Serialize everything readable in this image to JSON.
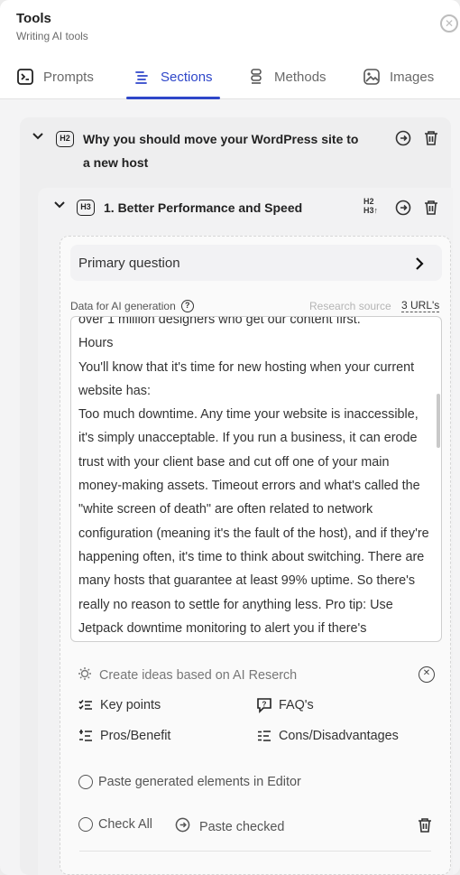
{
  "header": {
    "title": "Tools",
    "subtitle": "Writing AI tools",
    "close_icon": "close-circle-icon"
  },
  "tabs": [
    {
      "label": "Prompts",
      "icon": "prompt-terminal-icon",
      "active": false
    },
    {
      "label": "Sections",
      "icon": "sections-list-icon",
      "active": true
    },
    {
      "label": "Methods",
      "icon": "methods-stack-icon",
      "active": false
    },
    {
      "label": "Images",
      "icon": "image-icon",
      "active": false
    }
  ],
  "h2": {
    "badge": "H2",
    "title": "Why you should move your WordPress site to a new host"
  },
  "h3": {
    "badge": "H3",
    "title": "1. Better Performance and Speed",
    "convert_top": "H2",
    "convert_bottom": "H3↑"
  },
  "primary_question": {
    "label": "Primary question"
  },
  "data": {
    "label": "Data for AI generation",
    "research_label": "Research source",
    "research_link": "3 URL's",
    "text": "over 1 million designers who get our content first.\nHours\nYou'll know that it's time for new hosting when your current website has:\nToo much downtime. Any time your website is inaccessible, it's simply unacceptable. If you run a business, it can erode trust with your client base and cut off one of your main money-making assets. Timeout errors and what's called the \"white screen of death\" are often related to network configuration (meaning it's the fault of the host), and if they're happening often, it's time to think about switching. There are many hosts that guarantee at least 99% uptime. So there's really no reason to settle for anything less. Pro tip: Use Jetpack downtime monitoring to alert you if there's"
  },
  "ideas": {
    "title": "Create ideas based on AI Reserch",
    "items": [
      {
        "label": "Key points",
        "icon": "key-points-icon"
      },
      {
        "label": "FAQ's",
        "icon": "faq-icon"
      },
      {
        "label": "Pros/Benefit",
        "icon": "pros-icon"
      },
      {
        "label": "Cons/Disadvantages",
        "icon": "cons-icon"
      }
    ]
  },
  "actions": {
    "paste_editor": "Paste generated elements in Editor",
    "check_all": "Check All",
    "paste_checked": "Paste checked"
  },
  "colors": {
    "accent": "#2e46c9",
    "text": "#222222"
  }
}
